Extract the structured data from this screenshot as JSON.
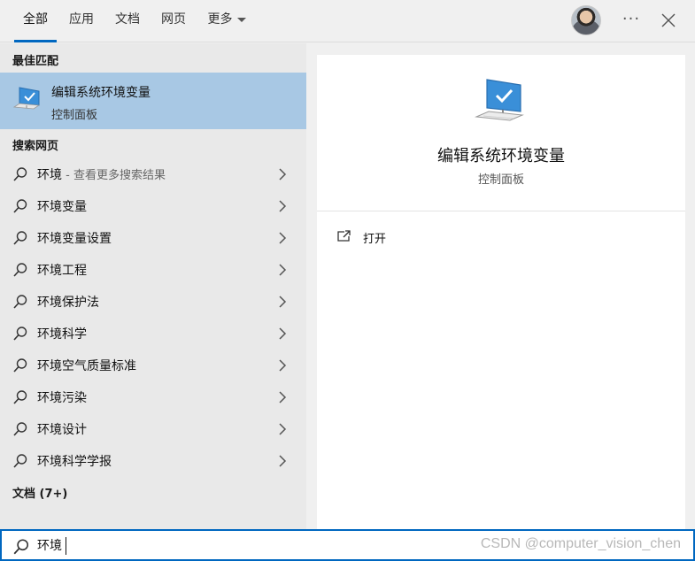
{
  "tabs": [
    {
      "label": "全部",
      "active": true
    },
    {
      "label": "应用",
      "active": false
    },
    {
      "label": "文档",
      "active": false
    },
    {
      "label": "网页",
      "active": false
    },
    {
      "label": "更多",
      "active": false
    }
  ],
  "header": {
    "more_glyph": "···"
  },
  "best_match": {
    "header": "最佳匹配",
    "title": "编辑系统环境变量",
    "subtitle": "控制面板",
    "icon": "monitor-check-icon"
  },
  "web": {
    "header": "搜索网页",
    "items": [
      {
        "label": "环境",
        "hint": " - 查看更多搜索结果"
      },
      {
        "label": "环境变量"
      },
      {
        "label": "环境变量设置"
      },
      {
        "label": "环境工程"
      },
      {
        "label": "环境保护法"
      },
      {
        "label": "环境科学"
      },
      {
        "label": "环境空气质量标准"
      },
      {
        "label": "环境污染"
      },
      {
        "label": "环境设计"
      },
      {
        "label": "环境科学学报"
      }
    ]
  },
  "docs": {
    "header": "文档 (7+)"
  },
  "detail": {
    "title": "编辑系统环境变量",
    "subtitle": "控制面板",
    "action_label": "打开"
  },
  "search": {
    "value": "环境"
  },
  "watermark": "CSDN @computer_vision_chen",
  "colors": {
    "accent": "#0067c0",
    "selected": "#a8c8e4"
  }
}
